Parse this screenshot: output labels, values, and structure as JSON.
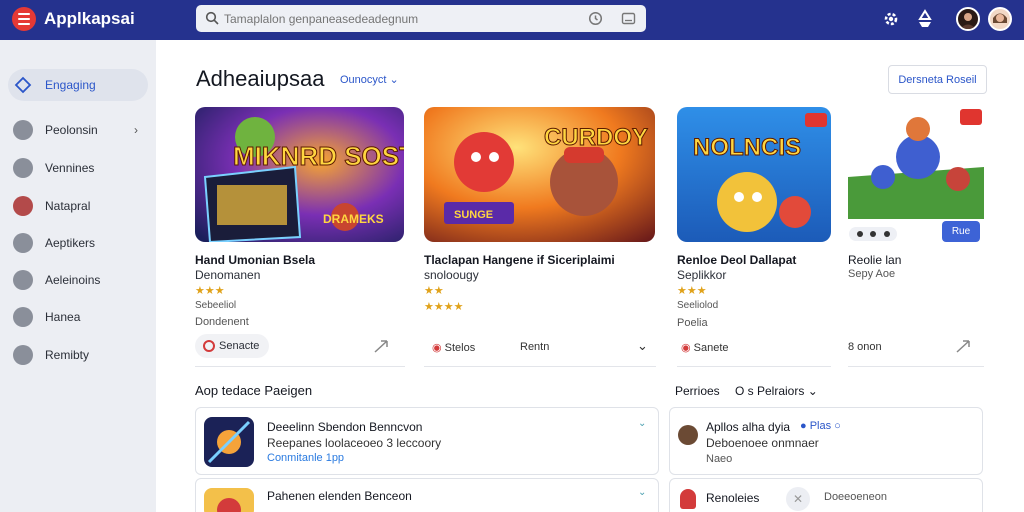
{
  "header": {
    "app_title": "Applkapsai",
    "search_placeholder": "Tamaplalon genpaneasedeadegnum",
    "icons": [
      "settings-icon",
      "recycle-icon"
    ],
    "colors": {
      "bar": "#25328e",
      "accent": "#2b56c9",
      "logo": "#e53935"
    }
  },
  "sidebar": {
    "items": [
      {
        "label": "Engaging",
        "icon": "diamond-icon",
        "active": true
      },
      {
        "label": "Peolonsin",
        "icon": "user-icon",
        "chevron": true
      },
      {
        "label": "Vennines",
        "icon": "grid-icon"
      },
      {
        "label": "Natapral",
        "icon": "leaf-icon"
      },
      {
        "label": "Aeptikers",
        "icon": "person-icon"
      },
      {
        "label": "Aeleinoins",
        "icon": "tag-icon"
      },
      {
        "label": "Hanea",
        "icon": "lock-icon"
      },
      {
        "label": "Remibty",
        "icon": "clock-icon"
      }
    ]
  },
  "main": {
    "title": "Adheaiupsaa",
    "filter_label": "Ounocyct",
    "top_action": "Dersneta Roseil",
    "cards": [
      {
        "art_title": "MIKNRD SOSTING",
        "art_sub": "DRAMEKS",
        "title": "Hand Umonian Bsela",
        "subtitle": "Denomanen",
        "rating": "★★★",
        "meta": "Sebeeliol",
        "publisher": "Dondenent",
        "action": "Senacte"
      },
      {
        "art_title": "CURDOY",
        "art_sub": "SUNGE",
        "title": "Tlaclapan Hangene if Siceriplaimi",
        "subtitle": "snoloougy",
        "rating": "★★",
        "rating2": "★★★★",
        "action": "Stelos",
        "action2": "Rentn"
      },
      {
        "art_title": "NOLNCIS",
        "title": "Renloe Deol Dallapat",
        "subtitle": "Seplikkor",
        "rating": "★★★",
        "meta": "Seeliolod",
        "publisher": "Poelia",
        "action": "Sanete"
      },
      {
        "title": "Reolie lan",
        "subtitle": "Sepy Aoe",
        "badge": "Rue",
        "action": "8 onon"
      }
    ]
  },
  "sections": {
    "left_title": "Aop tedace Paeigen",
    "right_title": "Perrioes",
    "right_filter": "O s Pelraiors",
    "left_list": [
      {
        "title": "Deeelinn Sbendon Benncvon",
        "subtitle": "Reepanes loolaceoeo 3 leccoory",
        "link": "Conmitanle 1pp"
      },
      {
        "title": "Pahenen elenden Benceon",
        "subtitle": ""
      }
    ],
    "right_list": [
      {
        "title": "Apllos alha dyia",
        "tag": "Plas",
        "subtitle": "Deboenoee onmnaer",
        "meta": "Naeo"
      },
      {
        "title": "Renoleies",
        "meta": "Doeeoeneon"
      }
    ]
  }
}
